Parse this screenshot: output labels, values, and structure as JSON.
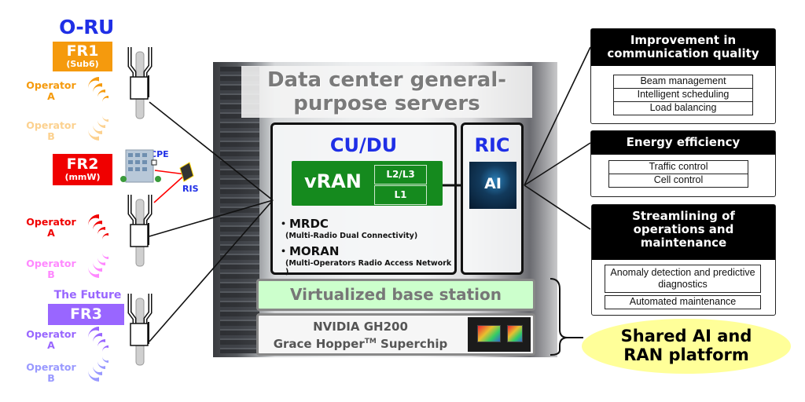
{
  "oru": {
    "title": "O-RU",
    "fr1": {
      "label": "FR1",
      "sub": "(Sub6)",
      "color": "#f59a0d",
      "operator_a": [
        "Operator",
        "A"
      ],
      "operator_b": [
        "Operator",
        "B"
      ],
      "color_a": "#f59a0d",
      "color_b": "#fcd18f"
    },
    "fr2": {
      "label": "FR2",
      "sub": "(mmW)",
      "color": "#f00000",
      "operator_a": [
        "Operator",
        "A"
      ],
      "operator_b": [
        "Operator",
        "B"
      ],
      "color_a": "#f00000",
      "color_b": "#ff88ff",
      "cpe": "CPE",
      "ris": "RIS"
    },
    "fr3": {
      "pre": "The Future",
      "label": "FR3",
      "color": "#9966ff",
      "operator_a": [
        "Operator",
        "A"
      ],
      "operator_b": [
        "Operator",
        "B"
      ],
      "color_a": "#9966ff",
      "color_b": "#9999ff"
    }
  },
  "center": {
    "dc_title": [
      "Data center general-",
      "purpose servers"
    ],
    "cudu_title": "CU/DU",
    "vran": {
      "label": "vRAN",
      "layers": [
        "L2/L3",
        "L1"
      ],
      "color": "#158a1e"
    },
    "bullets": [
      {
        "main": "・MRDC",
        "sub": "(Multi-Radio Dual Connectivity)"
      },
      {
        "main": "・MORAN",
        "sub": "(Multi-Operators Radio Access Network )"
      }
    ],
    "ric_title": "RIC",
    "ai_label": "AI",
    "vbs_label": "Virtualized base station",
    "nvidia": {
      "line1": "NVIDIA GH200",
      "line2": "Grace Hopper",
      "tm": "TM",
      "line2b": " Superchip"
    }
  },
  "right": {
    "boxes": [
      {
        "title": [
          "Improvement in",
          "communication quality"
        ],
        "items": [
          "Beam management",
          "Intelligent scheduling",
          "Load balancing"
        ]
      },
      {
        "title": [
          "Energy efficiency"
        ],
        "items": [
          "Traffic control",
          "Cell control"
        ]
      },
      {
        "title": [
          "Streamlining of",
          "operations and",
          "maintenance"
        ],
        "items": [
          "Anomaly detection and predictive diagnostics",
          "Automated maintenance"
        ]
      }
    ],
    "shared": [
      "Shared AI and",
      "RAN platform"
    ]
  }
}
